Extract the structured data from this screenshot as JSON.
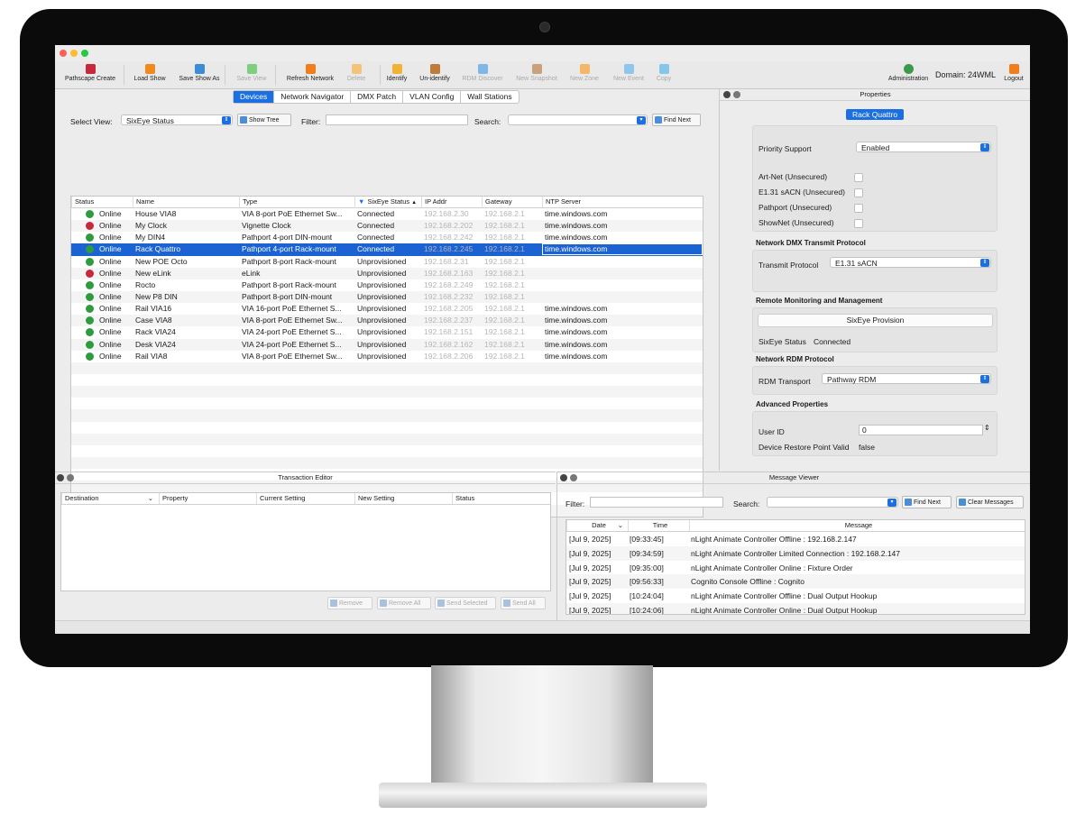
{
  "toolbar": {
    "items": [
      {
        "label": "Pathscape Create",
        "color": "#c8283c",
        "enabled": true
      },
      {
        "label": "Load Show",
        "color": "#f08a1c",
        "enabled": true
      },
      {
        "label": "Save Show As",
        "color": "#3a8bd8",
        "enabled": true
      },
      {
        "label": "Save View",
        "color": "#7fcf7f",
        "enabled": false
      },
      {
        "label": "Refresh Network",
        "color": "#f07e1a",
        "enabled": true
      },
      {
        "label": "Delete",
        "color": "#f5c27a",
        "enabled": false
      },
      {
        "label": "Identify",
        "color": "#f3b233",
        "enabled": true
      },
      {
        "label": "Un-identify",
        "color": "#c07a3a",
        "enabled": true
      },
      {
        "label": "RDM Discover",
        "color": "#7fb7e6",
        "enabled": false
      },
      {
        "label": "New Snapshot",
        "color": "#c9a17a",
        "enabled": false
      },
      {
        "label": "New Zone",
        "color": "#f5b66a",
        "enabled": false
      },
      {
        "label": "New Event",
        "color": "#8fc6ec",
        "enabled": false
      },
      {
        "label": "Copy",
        "color": "#86c6e8",
        "enabled": false
      }
    ],
    "administration": "Administration",
    "domain": "Domain: 24WML",
    "logout": "Logout"
  },
  "tabs": [
    "Devices",
    "Network Navigator",
    "DMX Patch",
    "VLAN Config",
    "Wall Stations"
  ],
  "devices": {
    "select_view_label": "Select View:",
    "select_view_value": "SixEye Status",
    "show_tree": "Show Tree",
    "filter_label": "Filter:",
    "search_label": "Search:",
    "find_next": "Find Next",
    "columns": [
      "Status",
      "Name",
      "Type",
      "SixEye Status",
      "IP Addr",
      "Gateway",
      "NTP Server"
    ],
    "rows": [
      {
        "status": "Online",
        "name": "House VIA8",
        "type": "VIA 8-port PoE Ethernet Sw...",
        "sixeye": "Connected",
        "ip": "192.168.2.30",
        "gw": "192.168.2.1",
        "ntp": "time.windows.com",
        "icon": "#2e9c3e"
      },
      {
        "status": "Online",
        "name": "My Clock",
        "type": "Vignette Clock",
        "sixeye": "Connected",
        "ip": "192.168.2.202",
        "gw": "192.168.2.1",
        "ntp": "time.windows.com",
        "icon": "#c8283c"
      },
      {
        "status": "Online",
        "name": "My DIN4",
        "type": "Pathport 4-port DIN-mount",
        "sixeye": "Connected",
        "ip": "192.168.2.242",
        "gw": "192.168.2.1",
        "ntp": "time.windows.com",
        "icon": "#2e9c3e"
      },
      {
        "status": "Online",
        "name": "Rack Quattro",
        "type": "Pathport 4-port Rack-mount",
        "sixeye": "Connected",
        "ip": "192.168.2.245",
        "gw": "192.168.2.1",
        "ntp": "time.windows.com",
        "icon": "#2e9c3e"
      },
      {
        "status": "Online",
        "name": "New POE Octo",
        "type": "Pathport 8-port Rack-mount",
        "sixeye": "Unprovisioned",
        "ip": "192.168.2.31",
        "gw": "192.168.2.1",
        "ntp": "",
        "icon": "#2e9c3e"
      },
      {
        "status": "Online",
        "name": "New eLink",
        "type": "eLink",
        "sixeye": "Unprovisioned",
        "ip": "192.168.2.163",
        "gw": "192.168.2.1",
        "ntp": "",
        "icon": "#c8283c"
      },
      {
        "status": "Online",
        "name": "Rocto",
        "type": "Pathport 8-port Rack-mount",
        "sixeye": "Unprovisioned",
        "ip": "192.168.2.249",
        "gw": "192.168.2.1",
        "ntp": "",
        "icon": "#2e9c3e"
      },
      {
        "status": "Online",
        "name": "New P8 DIN",
        "type": "Pathport 8-port DIN-mount",
        "sixeye": "Unprovisioned",
        "ip": "192.168.2.232",
        "gw": "192.168.2.1",
        "ntp": "",
        "icon": "#2e9c3e"
      },
      {
        "status": "Online",
        "name": "Rail VIA16",
        "type": "VIA 16-port PoE Ethernet S...",
        "sixeye": "Unprovisioned",
        "ip": "192.168.2.205",
        "gw": "192.168.2.1",
        "ntp": "time.windows.com",
        "icon": "#2e9c3e"
      },
      {
        "status": "Online",
        "name": "Case VIA8",
        "type": "VIA 8-port PoE Ethernet Sw...",
        "sixeye": "Unprovisioned",
        "ip": "192.168.2.237",
        "gw": "192.168.2.1",
        "ntp": "time.windows.com",
        "icon": "#2e9c3e"
      },
      {
        "status": "Online",
        "name": "Rack VIA24",
        "type": "VIA 24-port PoE Ethernet S...",
        "sixeye": "Unprovisioned",
        "ip": "192.168.2.151",
        "gw": "192.168.2.1",
        "ntp": "time.windows.com",
        "icon": "#2e9c3e"
      },
      {
        "status": "Online",
        "name": "Desk VIA24",
        "type": "VIA 24-port PoE Ethernet S...",
        "sixeye": "Unprovisioned",
        "ip": "192.168.2.162",
        "gw": "192.168.2.1",
        "ntp": "time.windows.com",
        "icon": "#2e9c3e"
      },
      {
        "status": "Online",
        "name": "Rail VIA8",
        "type": "VIA 8-port PoE Ethernet Sw...",
        "sixeye": "Unprovisioned",
        "ip": "192.168.2.206",
        "gw": "192.168.2.1",
        "ntp": "time.windows.com",
        "icon": "#2e9c3e"
      }
    ],
    "selected_row": 3
  },
  "properties": {
    "title": "Properties",
    "device_badge": "Rack Quattro",
    "priority_support_label": "Priority Support",
    "priority_support_value": "Enabled",
    "protocols": [
      "Art-Net (Unsecured)",
      "E1.31 sACN (Unsecured)",
      "Pathport (Unsecured)",
      "ShowNet (Unsecured)"
    ],
    "dmx_section": "Network DMX Transmit Protocol",
    "transmit_label": "Transmit Protocol",
    "transmit_value": "E1.31 sACN",
    "rmm_section": "Remote Monitoring and Management",
    "sixeye_provision": "SixEye Provision",
    "sixeye_status_label": "SixEye Status",
    "sixeye_status_value": "Connected",
    "rdm_section": "Network RDM Protocol",
    "rdm_label": "RDM Transport",
    "rdm_value": "Pathway RDM",
    "adv_section": "Advanced Properties",
    "user_id_label": "User ID",
    "user_id_value": "0",
    "restore_label": "Device Restore Point Valid",
    "restore_value": "false"
  },
  "transaction": {
    "title": "Transaction Editor",
    "columns": [
      "Destination",
      "Property",
      "Current Setting",
      "New Setting",
      "Status"
    ],
    "buttons": [
      "Remove",
      "Remove All",
      "Send Selected",
      "Send All"
    ]
  },
  "messages": {
    "title": "Message Viewer",
    "filter_label": "Filter:",
    "search_label": "Search:",
    "find_next": "Find Next",
    "clear": "Clear Messages",
    "columns": [
      "Date",
      "Time",
      "Message"
    ],
    "rows": [
      {
        "date": "[Jul 9, 2025]",
        "time": "[09:33:45]",
        "msg": "nLight Animate Controller Offline : 192.168.2.147"
      },
      {
        "date": "[Jul 9, 2025]",
        "time": "[09:34:59]",
        "msg": "nLight Animate Controller Limited Connection : 192.168.2.147"
      },
      {
        "date": "[Jul 9, 2025]",
        "time": "[09:35:00]",
        "msg": "nLight Animate Controller Online : Fixture Order"
      },
      {
        "date": "[Jul 9, 2025]",
        "time": "[09:56:33]",
        "msg": "Cognito Console Offline : Cognito"
      },
      {
        "date": "[Jul 9, 2025]",
        "time": "[10:24:04]",
        "msg": "nLight Animate Controller Offline : Dual Output Hookup"
      },
      {
        "date": "[Jul 9, 2025]",
        "time": "[10:24:06]",
        "msg": "nLight Animate Controller Online : Dual Output Hookup"
      }
    ]
  }
}
